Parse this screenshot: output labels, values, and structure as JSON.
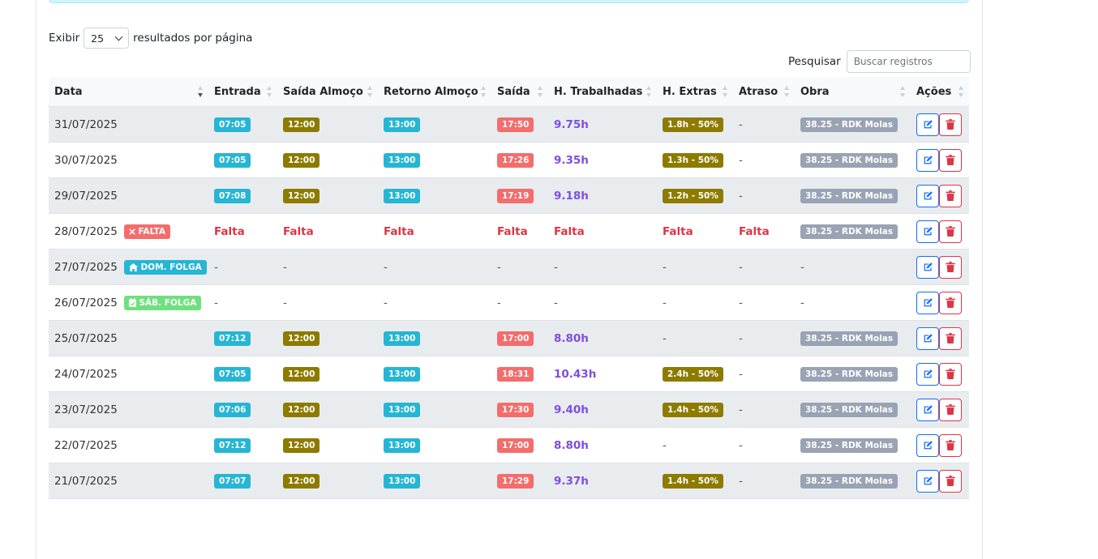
{
  "length_control": {
    "prefix": "Exibir",
    "value": "25",
    "suffix": "resultados por página"
  },
  "search": {
    "label": "Pesquisar",
    "placeholder": "Buscar registros"
  },
  "columns": [
    "Data",
    "Entrada",
    "Saída Almoço",
    "Retorno Almoço",
    "Saída",
    "H. Trabalhadas",
    "H. Extras",
    "Atraso",
    "Obra",
    "Ações"
  ],
  "rows": [
    {
      "date": "31/07/2025",
      "status": "",
      "entrada": "07:05",
      "saida_almoco": "12:00",
      "retorno": "13:00",
      "saida": "17:50",
      "horas": "9.75h",
      "extras": "1.8h - 50%",
      "atraso": "-",
      "obra": "38.25 - RDK Molas"
    },
    {
      "date": "30/07/2025",
      "status": "",
      "entrada": "07:05",
      "saida_almoco": "12:00",
      "retorno": "13:00",
      "saida": "17:26",
      "horas": "9.35h",
      "extras": "1.3h - 50%",
      "atraso": "-",
      "obra": "38.25 - RDK Molas"
    },
    {
      "date": "29/07/2025",
      "status": "",
      "entrada": "07:08",
      "saida_almoco": "12:00",
      "retorno": "13:00",
      "saida": "17:19",
      "horas": "9.18h",
      "extras": "1.2h - 50%",
      "atraso": "-",
      "obra": "38.25 - RDK Molas"
    },
    {
      "date": "28/07/2025",
      "status": "FALTA",
      "entrada": "Falta",
      "saida_almoco": "Falta",
      "retorno": "Falta",
      "saida": "Falta",
      "horas": "Falta",
      "extras": "Falta",
      "atraso": "Falta",
      "obra": "38.25 - RDK Molas"
    },
    {
      "date": "27/07/2025",
      "status": "DOM. FOLGA",
      "entrada": "-",
      "saida_almoco": "-",
      "retorno": "-",
      "saida": "-",
      "horas": "-",
      "extras": "-",
      "atraso": "-",
      "obra": "-"
    },
    {
      "date": "26/07/2025",
      "status": "SÁB. FOLGA",
      "entrada": "-",
      "saida_almoco": "-",
      "retorno": "-",
      "saida": "-",
      "horas": "-",
      "extras": "-",
      "atraso": "-",
      "obra": "-"
    },
    {
      "date": "25/07/2025",
      "status": "",
      "entrada": "07:12",
      "saida_almoco": "12:00",
      "retorno": "13:00",
      "saida": "17:00",
      "horas": "8.80h",
      "extras": "-",
      "atraso": "-",
      "obra": "38.25 - RDK Molas"
    },
    {
      "date": "24/07/2025",
      "status": "",
      "entrada": "07:05",
      "saida_almoco": "12:00",
      "retorno": "13:00",
      "saida": "18:31",
      "horas": "10.43h",
      "extras": "2.4h - 50%",
      "atraso": "-",
      "obra": "38.25 - RDK Molas"
    },
    {
      "date": "23/07/2025",
      "status": "",
      "entrada": "07:06",
      "saida_almoco": "12:00",
      "retorno": "13:00",
      "saida": "17:30",
      "horas": "9.40h",
      "extras": "1.4h - 50%",
      "atraso": "-",
      "obra": "38.25 - RDK Molas"
    },
    {
      "date": "22/07/2025",
      "status": "",
      "entrada": "07:12",
      "saida_almoco": "12:00",
      "retorno": "13:00",
      "saida": "17:00",
      "horas": "8.80h",
      "extras": "-",
      "atraso": "-",
      "obra": "38.25 - RDK Molas"
    },
    {
      "date": "21/07/2025",
      "status": "",
      "entrada": "07:07",
      "saida_almoco": "12:00",
      "retorno": "13:00",
      "saida": "17:29",
      "horas": "9.37h",
      "extras": "1.4h - 50%",
      "atraso": "-",
      "obra": "38.25 - RDK Molas"
    }
  ],
  "colors": {
    "entrada": "#26b6d4",
    "almoco": "#8d7b00",
    "saida": "#f36d6d",
    "obra": "#9aa3b4",
    "hours": "#7b4fe0",
    "falta": "#dc3545"
  },
  "icons": {
    "edit": "edit-icon",
    "delete": "trash-icon",
    "falta": "x-icon",
    "domingo": "home-icon",
    "sabado": "calendar-icon"
  }
}
